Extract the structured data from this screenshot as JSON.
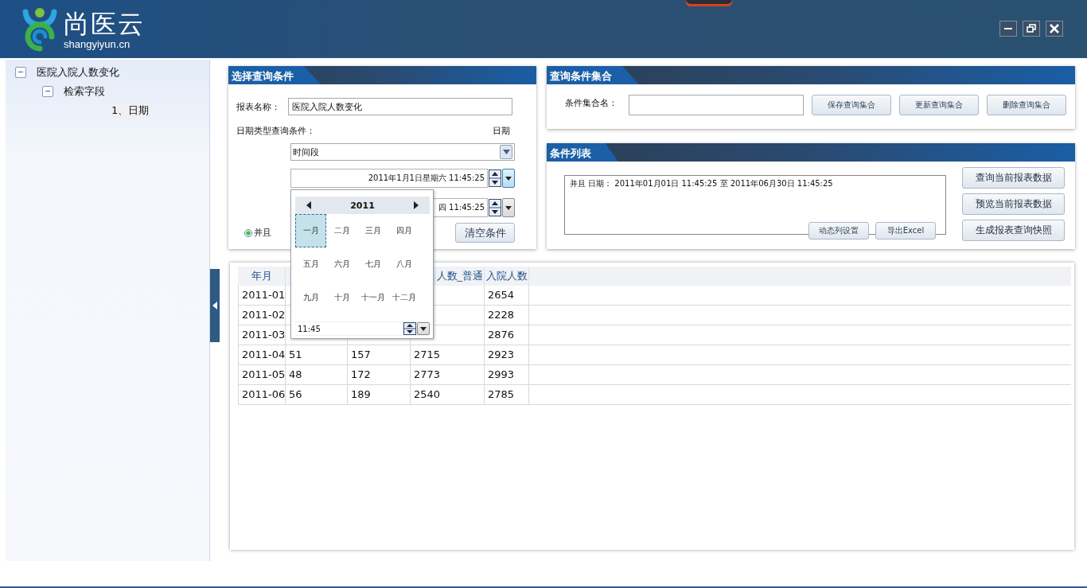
{
  "app": {
    "logo_text": "尚医云",
    "logo_subtitle": "shangyiyun.cn"
  },
  "tree": [
    {
      "label": "医院入院人数变化",
      "expanded": true,
      "children": [
        {
          "label": "检索字段",
          "expanded": true,
          "children": [
            {
              "label": "1、日期",
              "selected": true
            }
          ]
        }
      ]
    }
  ],
  "query_panel": {
    "title": "选择查询条件",
    "report_name_label": "报表名称：",
    "report_name": "医院入院人数变化",
    "date_condition_label": "日期类型查询条件：",
    "field_label": "日期",
    "range_type": "时间段",
    "start_value": "2011年1月1日星期六 11:45:25",
    "end_value": "四 11:45:25",
    "logic": [
      {
        "label": "并且",
        "selected": true
      }
    ],
    "clear_button": "清空条件"
  },
  "calendar": {
    "year": "2011",
    "months": [
      {
        "label": "一月",
        "selected": true
      },
      {
        "label": "二月",
        "selected": false
      },
      {
        "label": "三月",
        "selected": false
      },
      {
        "label": "四月",
        "selected": false
      },
      {
        "label": "五月",
        "selected": false
      },
      {
        "label": "六月",
        "selected": false
      },
      {
        "label": "七月",
        "selected": false
      },
      {
        "label": "八月",
        "selected": false
      },
      {
        "label": "九月",
        "selected": false
      },
      {
        "label": "十月",
        "selected": false
      },
      {
        "label": "十一月",
        "selected": false
      },
      {
        "label": "十二月",
        "selected": false
      }
    ],
    "time": "11:45"
  },
  "set_panel": {
    "title": "查询条件集合",
    "name_label": "条件集合名：",
    "buttons": [
      "保存查询集合",
      "更新查询集合",
      "删除查询集合"
    ]
  },
  "condition_panel": {
    "title": "条件列表",
    "condition_text": "并且 日期： 2011年01月01日 11:45:25 至 2011年06月30日 11:45:25",
    "inner_buttons": [
      "动态列设置",
      "导出Excel"
    ],
    "buttons": [
      "查询当前报表数据",
      "预览当前报表数据",
      "生成报表查询快照"
    ]
  },
  "table": {
    "columns": [
      "年月",
      null,
      null,
      "人数_普通",
      "入院人数"
    ],
    "rows": [
      [
        "2011-01",
        null,
        null,
        null,
        "2654"
      ],
      [
        "2011-02",
        null,
        null,
        null,
        "2228"
      ],
      [
        "2011-03",
        null,
        null,
        null,
        "2876"
      ],
      [
        "2011-04",
        "51",
        "157",
        "2715",
        "2923"
      ],
      [
        "2011-05",
        "48",
        "172",
        "2773",
        "2993"
      ],
      [
        "2011-06",
        "56",
        "189",
        "2540",
        "2785"
      ]
    ]
  }
}
